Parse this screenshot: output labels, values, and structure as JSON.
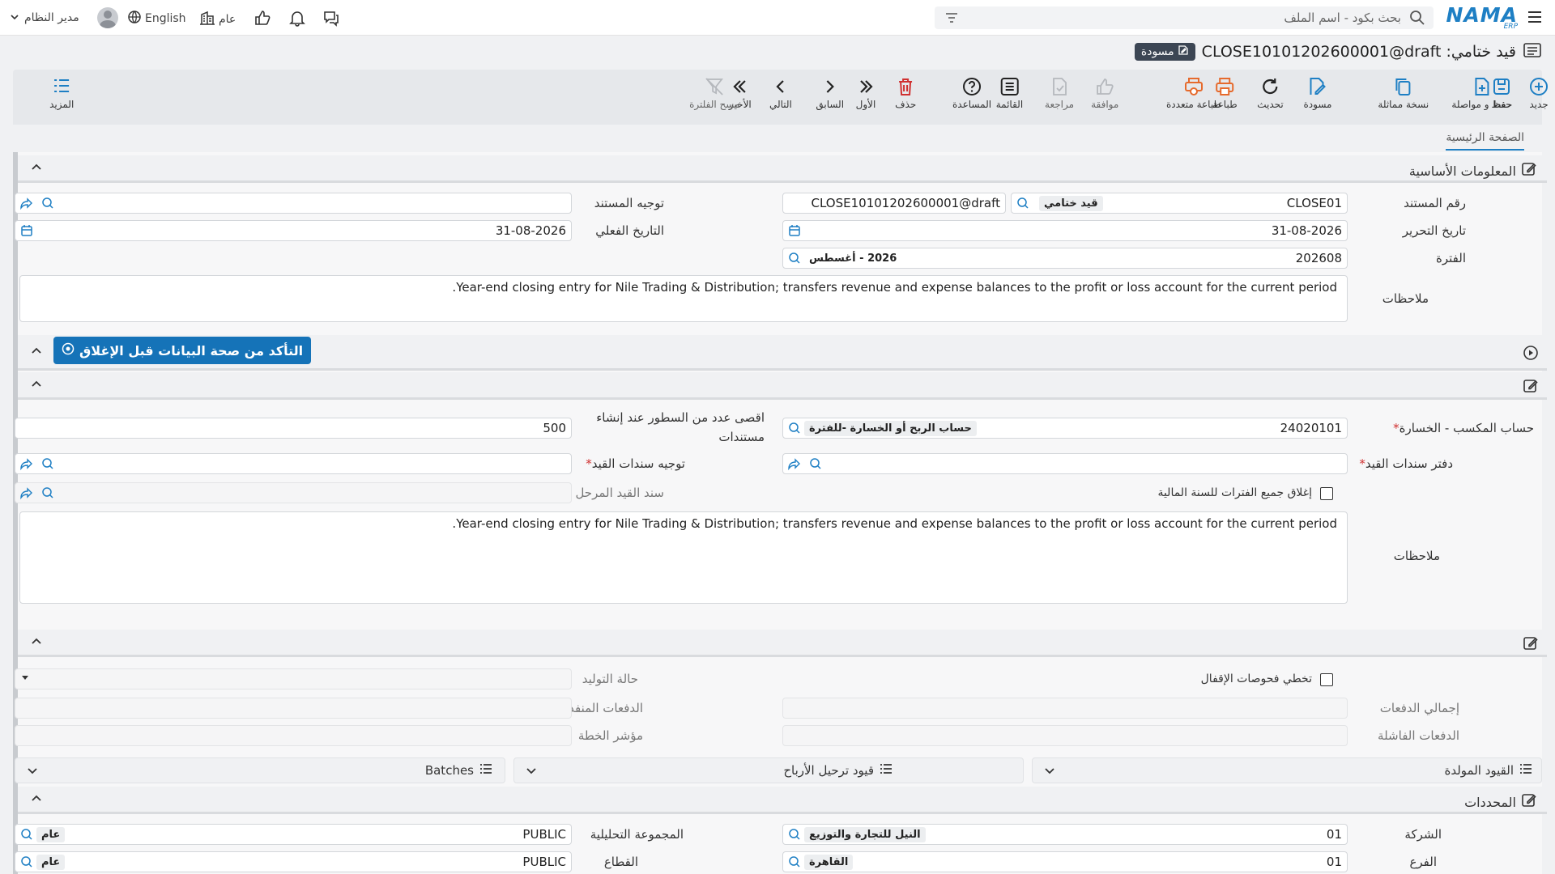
{
  "topbar": {
    "logo": "NAMA",
    "logo_sub": "ERP",
    "search_placeholder": "بحث بكود - اسم الملف",
    "user_name": "مدير النظام",
    "language": "English",
    "context": "عام"
  },
  "title": {
    "text": "قيد ختامي: CLOSE10101202600001@draft",
    "badge": "مسودة"
  },
  "toolbar": {
    "new": "جديد",
    "save": "حفظ",
    "save_continue": "حفظ و مواصلة",
    "duplicate": "نسخة مماثلة",
    "draft": "مسودة",
    "refresh": "تحديث",
    "print": "طباعة",
    "multi_print": "طباعة متعددة",
    "approve": "موافقة",
    "review": "مراجعة",
    "list": "القائمة",
    "help": "المساعدة",
    "delete": "حذف",
    "first": "الأول",
    "previous": "السابق",
    "next": "التالي",
    "last": "الأخير",
    "clear_filter": "مسح الفلترة",
    "more": "المزيد"
  },
  "tabs": {
    "main": "الصفحة الرئيسية"
  },
  "basic": {
    "title": "المعلومات الأساسية",
    "doc_number_label": "رقم المستند",
    "doc_number_value": "CLOSE01",
    "doc_type": "قيد ختامي",
    "doc_code": "CLOSE10101202600001@draft",
    "doc_routing_label": "توجيه المستند",
    "issue_date_label": "تاريخ التحرير",
    "issue_date_value": "31-08-2026",
    "actual_date_label": "التاريخ الفعلي",
    "actual_date_value": "31-08-2026",
    "period_label": "الفترة",
    "period_value": "202608",
    "period_desc": "2026 - أغسطس",
    "notes_label": "ملاحظات",
    "notes_value": "Year-end closing entry for Nile Trading & Distribution; transfers revenue and expense balances to the profit or loss account for the current period."
  },
  "validate_button": "التأكد من صحة البيانات قبل الإغلاق",
  "details": {
    "pl_account_label": "حساب المكسب - الخسارة",
    "pl_account_value": "24020101",
    "pl_account_desc": "حساب الربح أو الخسارة -للفترة",
    "max_lines_label": "اقصى عدد من السطور عند إنشاء مستندات",
    "max_lines_value": "500",
    "journal_book_label": "دفتر سندات القيد",
    "journal_routing_label": "توجيه سندات القيد",
    "close_all_label": "إغلاق جميع الفترات للسنة المالية",
    "posted_voucher_label": "سند القيد المرحل",
    "notes_label": "ملاحظات",
    "notes_value": "Year-end closing entry for Nile Trading & Distribution; transfers revenue and expense balances to the profit or loss account for the current period."
  },
  "generation": {
    "skip_checks_label": "تخطي فحوصات الإقفال",
    "gen_status_label": "حالة التوليد",
    "total_batches_label": "إجمالي الدفعات",
    "executed_batches_label": "الدفعات المنفذة",
    "failed_batches_label": "الدفعات الفاشلة",
    "error_indicator_label": "مؤشر الخطة"
  },
  "grids": {
    "generated_entries": "القيود المولدة",
    "profit_entries": "قيود ترحيل الأرباح",
    "batches": "Batches"
  },
  "dimensions": {
    "title": "المحددات",
    "company_label": "الشركة",
    "company_value": "01",
    "company_desc": "النيل للتجارة والتوزيع",
    "analysis_group_label": "المجموعة التحليلية",
    "analysis_group_value": "PUBLIC",
    "analysis_group_desc": "عام",
    "branch_label": "الفرع",
    "branch_value": "01",
    "branch_desc": "القاهرة",
    "sector_label": "القطاع",
    "sector_value": "PUBLIC",
    "sector_desc": "عام"
  }
}
